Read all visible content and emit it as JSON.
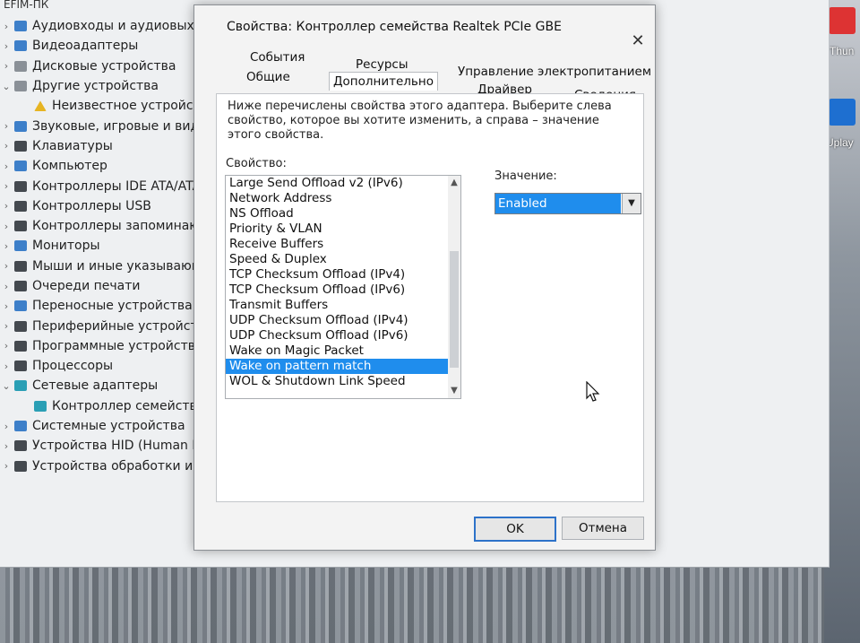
{
  "device_manager": {
    "computer_name": "EFIM-ПК",
    "tree": [
      {
        "label": "Аудиовходы и аудиовыход",
        "expander": "›"
      },
      {
        "label": "Видеоадаптеры",
        "expander": "›"
      },
      {
        "label": "Дисковые устройства",
        "expander": "›"
      },
      {
        "label": "Другие устройства",
        "expander": "⌄"
      },
      {
        "label": "Неизвестное устройств",
        "expander": "",
        "indent": true
      },
      {
        "label": "Звуковые, игровые и видео",
        "expander": "›"
      },
      {
        "label": "Клавиатуры",
        "expander": "›"
      },
      {
        "label": "Компьютер",
        "expander": "›"
      },
      {
        "label": "Контроллеры IDE ATA/ATA",
        "expander": "›"
      },
      {
        "label": "Контроллеры USB",
        "expander": "›"
      },
      {
        "label": "Контроллеры запоминающ",
        "expander": "›"
      },
      {
        "label": "Мониторы",
        "expander": "›"
      },
      {
        "label": "Мыши и иные указывающ",
        "expander": "›"
      },
      {
        "label": "Очереди печати",
        "expander": "›"
      },
      {
        "label": "Переносные устройства",
        "expander": "›"
      },
      {
        "label": "Периферийные устройства",
        "expander": "›"
      },
      {
        "label": "Программные устройства",
        "expander": "›"
      },
      {
        "label": "Процессоры",
        "expander": "›"
      },
      {
        "label": "Сетевые адаптеры",
        "expander": "⌄"
      },
      {
        "label": "Контроллер семейства",
        "expander": "",
        "indent": true
      },
      {
        "label": "Системные устройства",
        "expander": "›"
      },
      {
        "label": "Устройства HID (Human In",
        "expander": "›"
      },
      {
        "label": "Устройства обработки изо",
        "expander": "›"
      }
    ]
  },
  "dialog": {
    "title": "Свойства: Контроллер семейства Realtek PCIe GBE",
    "close_label": "✕",
    "tabs_row1": [
      "События",
      "Ресурсы",
      "Управление электропитанием"
    ],
    "tabs_row2": [
      "Общие",
      "Дополнительно",
      "Драйвер",
      "Сведения"
    ],
    "active_tab": "Дополнительно",
    "description": "Ниже перечислены свойства этого адаптера. Выберите слева свойство, которое вы хотите изменить, а справа – значение этого свойства.",
    "property_label": "Свойство:",
    "value_label": "Значение:",
    "properties": [
      "Large Send Offload v2 (IPv6)",
      "Network Address",
      "NS Offload",
      "Priority & VLAN",
      "Receive Buffers",
      "Speed & Duplex",
      "TCP Checksum Offload (IPv4)",
      "TCP Checksum Offload (IPv6)",
      "Transmit Buffers",
      "UDP Checksum Offload (IPv4)",
      "UDP Checksum Offload (IPv6)",
      "Wake on Magic Packet",
      "Wake on pattern match",
      "WOL & Shutdown Link Speed"
    ],
    "selected_property": "Wake on pattern match",
    "value": "Enabled",
    "ok_label": "OK",
    "cancel_label": "Отмена"
  },
  "desktop": {
    "icon_labels": [
      "rThun",
      "Uplay"
    ]
  },
  "colors": {
    "selection": "#1f8ded",
    "window_bg": "#f3f3f3"
  }
}
